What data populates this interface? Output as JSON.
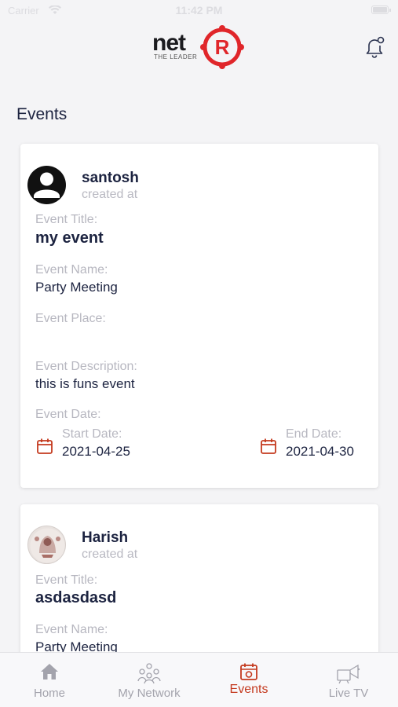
{
  "status_bar": {
    "carrier": "Carrier",
    "time": "11:42 PM"
  },
  "header": {
    "logo_text": "net",
    "logo_letter": "R",
    "logo_tagline": "THE LEADER",
    "notification_icon": "bell-icon"
  },
  "page": {
    "title": "Events"
  },
  "events": [
    {
      "username": "santosh",
      "created_label": "created at",
      "title_label": "Event Title:",
      "title": "my event",
      "name_label": "Event Name:",
      "name": "Party Meeting",
      "place_label": "Event Place:",
      "place": "",
      "description_label": "Event Description:",
      "description": "this is funs event",
      "date_label": "Event Date:",
      "start_label": "Start Date:",
      "start_date": "2021-04-25",
      "end_label": "End Date:",
      "end_date": "2021-04-30"
    },
    {
      "username": "Harish",
      "created_label": "created at",
      "title_label": "Event Title:",
      "title": "asdasdasd",
      "name_label": "Event Name:",
      "name": "Party Meeting"
    }
  ],
  "tabs": [
    {
      "label": "Home",
      "icon": "home-icon",
      "active": false
    },
    {
      "label": "My Network",
      "icon": "network-icon",
      "active": false
    },
    {
      "label": "Events",
      "icon": "calendar-icon",
      "active": true
    },
    {
      "label": "Live TV",
      "icon": "live-tv-icon",
      "active": false
    }
  ],
  "colors": {
    "accent": "#c43a1f",
    "text": "#1c2340",
    "muted": "#b7b7c0",
    "inactive_tab": "#a3a3ac"
  }
}
